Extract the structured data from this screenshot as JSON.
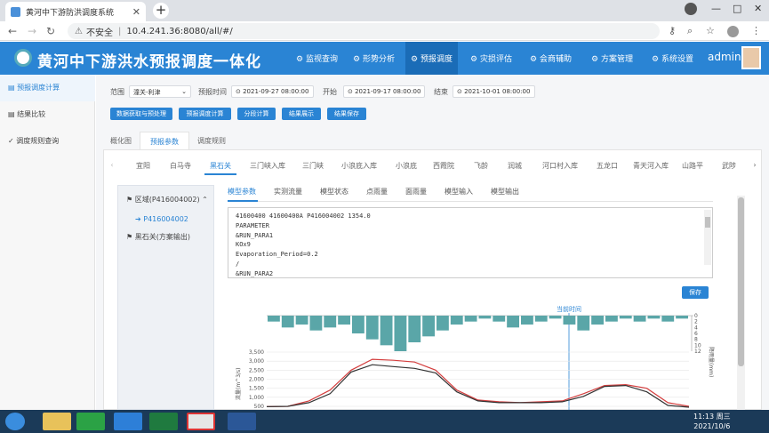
{
  "browser": {
    "tab_title": "黄河中下游防洪调度系统",
    "tab_close": "✕",
    "new_tab": "+",
    "not_secure": "不安全",
    "url": "10.4.241.36:8080/all/#/"
  },
  "app": {
    "title": "黄河中下游洪水预报调度一体化",
    "nav": [
      {
        "label": "监视查询"
      },
      {
        "label": "形势分析"
      },
      {
        "label": "预报调度"
      },
      {
        "label": "灾损评估"
      },
      {
        "label": "会商辅助"
      },
      {
        "label": "方案管理"
      },
      {
        "label": "系统设置"
      }
    ],
    "user": "admin"
  },
  "sidebar": {
    "items": [
      {
        "label": "预报调度计算"
      },
      {
        "label": "结果比较"
      },
      {
        "label": "调度规则查询"
      }
    ]
  },
  "filters": {
    "range_label": "范围",
    "range_value": "潼关-利津",
    "forecast_time_label": "预报时间",
    "forecast_time_value": "2021-09-27 08:00:00",
    "start_label": "开始",
    "start_value": "2021-09-17 08:00:00",
    "end_label": "结束",
    "end_value": "2021-10-01 08:00:00"
  },
  "actions": {
    "btn1": "数据获取与预处理",
    "btn2": "预报调度计算",
    "btn3": "分段计算",
    "btn4": "结果展示",
    "btn5": "结果保存"
  },
  "main_tabs": [
    {
      "label": "概化图"
    },
    {
      "label": "预报参数"
    },
    {
      "label": "调度规则"
    }
  ],
  "station_tabs": [
    {
      "label": "宜阳"
    },
    {
      "label": "白马寺"
    },
    {
      "label": "黑石关"
    },
    {
      "label": "三门峡入库"
    },
    {
      "label": "三门峡"
    },
    {
      "label": "小浪底入库"
    },
    {
      "label": "小浪底"
    },
    {
      "label": "西霞院"
    },
    {
      "label": "飞龄"
    },
    {
      "label": "润城"
    },
    {
      "label": "河口村入库"
    },
    {
      "label": "五龙口"
    },
    {
      "label": "青天河入库"
    },
    {
      "label": "山路平"
    },
    {
      "label": "武陟"
    }
  ],
  "tree": {
    "region": "区域(P416004002)",
    "child": "P416004002",
    "output": "黑石关(方案输出)"
  },
  "param_tabs": [
    {
      "label": "模型参数"
    },
    {
      "label": "实测流量"
    },
    {
      "label": "模型状态"
    },
    {
      "label": "点雨量"
    },
    {
      "label": "面雨量"
    },
    {
      "label": "模型输入"
    },
    {
      "label": "模型输出"
    }
  ],
  "editor": {
    "lines": [
      "41600400 41600400A P416004002 1354.0",
      "PARAMETER",
      "&RUN_PARA1",
      "KOx9",
      "Evaporation_Period=0.2",
      "/",
      "&RUN_PARA2"
    ]
  },
  "save_button": "保存",
  "chart_data": {
    "type": "line",
    "marker_label": "当前时间",
    "ylabel": "流量(m^3/s)",
    "y2label": "降雨量(mm)",
    "yticks": [
      "3,500",
      "3,000",
      "2,500",
      "2,000",
      "1,500",
      "1,000",
      "500"
    ],
    "y2ticks": [
      "0",
      "2",
      "4",
      "6",
      "8",
      "10",
      "12"
    ],
    "series": [
      {
        "values": [
          480,
          500,
          800,
          1400,
          2500,
          3100,
          3050,
          2950,
          2500,
          1400,
          850,
          750,
          700,
          750,
          800,
          1200,
          1650,
          1700,
          1500,
          700,
          500
        ]
      },
      {
        "values": [
          480,
          500,
          700,
          1200,
          2400,
          2800,
          2700,
          2600,
          2350,
          1300,
          800,
          700,
          700,
          700,
          750,
          1050,
          1600,
          1650,
          1300,
          550,
          450
        ]
      }
    ],
    "rainfall": [
      2,
      4,
      3,
      5,
      4,
      3,
      6,
      8,
      10,
      12,
      9,
      7,
      5,
      3,
      2,
      1,
      2,
      4,
      3,
      2,
      1,
      3,
      5,
      3,
      2,
      1,
      2,
      1,
      2,
      1
    ]
  },
  "taskbar": {
    "time": "11:13 周三",
    "date": "2021/10/6"
  }
}
